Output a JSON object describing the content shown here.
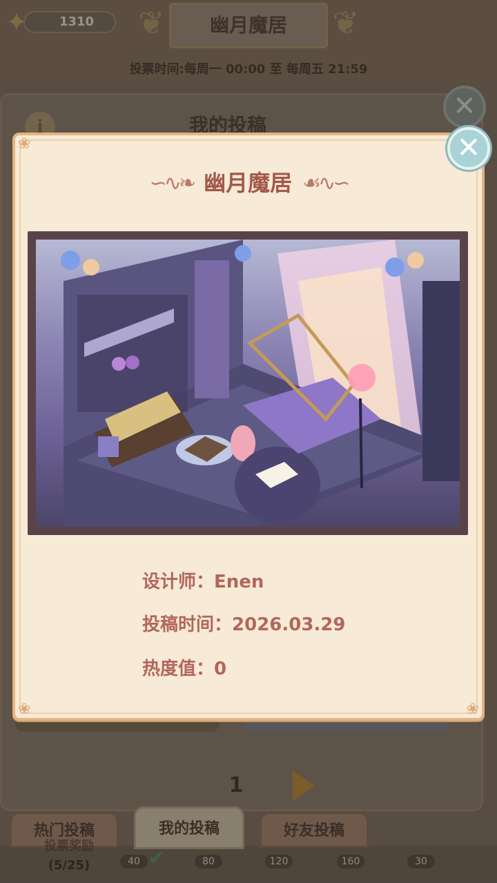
{
  "header": {
    "star_count": "1310",
    "title": "幽月魔居",
    "vote_time": "投票时间:每周一 00:00 至 每周五 21:59"
  },
  "background_panel": {
    "title": "我的投稿"
  },
  "modal": {
    "title": "幽月魔居",
    "designer_label": "设计师：",
    "designer": "Enen",
    "submit_label": "投稿时间：",
    "submit_date": "2026.03.29",
    "heat_label": "热度值：",
    "heat": "0"
  },
  "pagination": {
    "page": "1"
  },
  "tabs": [
    {
      "label": "热门投稿"
    },
    {
      "label": "我的投稿"
    },
    {
      "label": "好友投稿"
    }
  ],
  "progress": {
    "line1": "投票奖励",
    "line2": "(5/25)"
  },
  "rewards": [
    "40",
    "80",
    "120",
    "160",
    "30"
  ],
  "colors": {
    "modal_bg": "#f7ead6",
    "modal_border": "#e3b484",
    "title_color": "#a2584a",
    "info_text": "#b1675c",
    "close_button": "#a8d3d7",
    "next_arrow": "#b0802d"
  }
}
